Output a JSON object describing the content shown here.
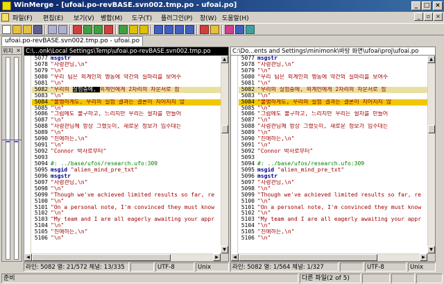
{
  "window": {
    "title": "WinMerge - [ufoai.po-revBASE.svn002.tmp.po - ufoai.po]",
    "minimize": "_",
    "maximize": "□",
    "close": "×"
  },
  "menu": {
    "items": [
      "파일(F)",
      "편집(E)",
      "보기(V)",
      "병합(M)",
      "도구(T)",
      "플러그인(P)",
      "창(W)",
      "도움말(H)"
    ],
    "mdi_minimize": "_",
    "mdi_restore": "▫",
    "mdi_close": "×"
  },
  "tab": {
    "label": "ufoai.po-revBASE.svn002.tmp.po - ufoai.po"
  },
  "location_pane": {
    "title": "위치",
    "close": "×"
  },
  "left_pane": {
    "path": "C:\\...onk\\Local Settings\\Temp\\ufoai.po-revBASE.svn002.tmp.po",
    "lines": [
      {
        "n": "5077",
        "parts": [
          {
            "t": "msgstr",
            "k": "k"
          }
        ]
      },
      {
        "n": "5078",
        "parts": [
          {
            "t": "\"사령관님,\\n\"",
            "k": "s"
          }
        ]
      },
      {
        "n": "5079",
        "parts": [
          {
            "t": "\"\\n\"",
            "k": "s"
          }
        ]
      },
      {
        "n": "5080",
        "parts": [
          {
            "t": "\"우리 팀은 외계인의 행동에 약간의 실마리를 보여주",
            "k": "s"
          }
        ]
      },
      {
        "n": "5081",
        "parts": [
          {
            "t": "\"\\n\"",
            "k": "s"
          }
        ]
      },
      {
        "n": "5082",
        "hl": "chg",
        "parts": [
          {
            "t": "\"우리의 ",
            "k": "s"
          },
          {
            "t": "실험중에, ",
            "k": "sel"
          },
          {
            "t": "외계인에게 2차리의 자문서로 잠",
            "k": "s"
          }
        ]
      },
      {
        "n": "5083",
        "parts": [
          {
            "t": "\"\\n\"",
            "k": "s"
          }
        ]
      },
      {
        "n": "5084",
        "hl": "yellow",
        "parts": [
          {
            "t": "\"불행하게도, 우리의 실험 결과는 결론이 지어지지 않",
            "k": "s"
          }
        ]
      },
      {
        "n": "5085",
        "parts": [
          {
            "t": "\"\\n\"",
            "k": "s"
          }
        ]
      },
      {
        "n": "5086",
        "parts": [
          {
            "t": "\"그럼에도 불구하고, 느리지만 우리는 절차를 만들어",
            "k": "s"
          }
        ]
      },
      {
        "n": "5087",
        "parts": [
          {
            "t": "\"\\n\"",
            "k": "s"
          }
        ]
      },
      {
        "n": "5088",
        "parts": [
          {
            "t": "\"사령관님께 항상 그랬듯이, 새로운 정보가 입수대는",
            "k": "s"
          }
        ]
      },
      {
        "n": "5089",
        "parts": [
          {
            "t": "\"\\n\"",
            "k": "s"
          }
        ]
      },
      {
        "n": "5090",
        "parts": [
          {
            "t": "\"친애하는,\\n\"",
            "k": "s"
          }
        ]
      },
      {
        "n": "5091",
        "parts": [
          {
            "t": "\"\\n\"",
            "k": "s"
          }
        ]
      },
      {
        "n": "5092",
        "parts": [
          {
            "t": "\"Connor 박사로부터\"",
            "k": "s"
          }
        ]
      },
      {
        "n": "5093",
        "parts": [
          {
            "t": "",
            "k": "s"
          }
        ]
      },
      {
        "n": "5094",
        "parts": [
          {
            "t": "#: ../base/ufos/research.ufo:309",
            "k": "c"
          }
        ]
      },
      {
        "n": "5095",
        "parts": [
          {
            "t": "msgid ",
            "k": "k"
          },
          {
            "t": "\"alien_mind_pre_txt\"",
            "k": "s"
          }
        ]
      },
      {
        "n": "5096",
        "parts": [
          {
            "t": "msgstr",
            "k": "k"
          }
        ]
      },
      {
        "n": "5097",
        "parts": [
          {
            "t": "\"사령관님,\\n\"",
            "k": "s"
          }
        ]
      },
      {
        "n": "5098",
        "parts": [
          {
            "t": "\"\\n\"",
            "k": "s"
          }
        ]
      },
      {
        "n": "5099",
        "parts": [
          {
            "t": "\"Though we've achieved limited results so far, re",
            "k": "s"
          }
        ]
      },
      {
        "n": "5100",
        "parts": [
          {
            "t": "\"\\n\"",
            "k": "s"
          }
        ]
      },
      {
        "n": "5101",
        "parts": [
          {
            "t": "\"On a personal note, I'm convinced they must know",
            "k": "s"
          }
        ]
      },
      {
        "n": "5102",
        "parts": [
          {
            "t": "\"\\n\"",
            "k": "s"
          }
        ]
      },
      {
        "n": "5103",
        "parts": [
          {
            "t": "\"My team and I are all eagerly awaiting your appr",
            "k": "s"
          }
        ]
      },
      {
        "n": "5104",
        "parts": [
          {
            "t": "\"\\n\"",
            "k": "s"
          }
        ]
      },
      {
        "n": "5105",
        "parts": [
          {
            "t": "\"친애하는,\\n\"",
            "k": "s"
          }
        ]
      },
      {
        "n": "5106",
        "parts": [
          {
            "t": "\"\\n\"",
            "k": "s"
          }
        ]
      }
    ],
    "status": {
      "pos": "라인: 5082  열: 21/572  체널: 13/335",
      "enc": "UTF-8",
      "eol": "Unix"
    }
  },
  "right_pane": {
    "path": "C:\\Do...ents and Settings\\minimonk\\바탕 화면\\ufoai\\proj\\ufoai.po",
    "lines": [
      {
        "n": "5077",
        "parts": [
          {
            "t": "msgstr",
            "k": "k"
          }
        ]
      },
      {
        "n": "5078",
        "parts": [
          {
            "t": "\"사령관님,\\n\"",
            "k": "s"
          }
        ]
      },
      {
        "n": "5079",
        "parts": [
          {
            "t": "\"\\n\"",
            "k": "s"
          }
        ]
      },
      {
        "n": "5080",
        "parts": [
          {
            "t": "\"우리 팀은 외계인의 행동에 약간의 실마리를 보여주",
            "k": "s"
          }
        ]
      },
      {
        "n": "5081",
        "parts": [
          {
            "t": "\"\\n\"",
            "k": "s"
          }
        ]
      },
      {
        "n": "5082",
        "hl": "chg",
        "parts": [
          {
            "t": "\"우리의 실험중에, 외계인에게 2차리의 자문서로 잠",
            "k": "s"
          }
        ]
      },
      {
        "n": "5083",
        "parts": [
          {
            "t": "\"\\n\"",
            "k": "s"
          }
        ]
      },
      {
        "n": "5084",
        "hl": "yellow",
        "parts": [
          {
            "t": "\"불행하게도, 우리의 실험 결과는 결론이 지어지지 않",
            "k": "s"
          }
        ]
      },
      {
        "n": "5085",
        "parts": [
          {
            "t": "\"\\n\"",
            "k": "s"
          }
        ]
      },
      {
        "n": "5086",
        "parts": [
          {
            "t": "\"그럼에도 불구하고, 느리지만 우리는 절차를 만들어",
            "k": "s"
          }
        ]
      },
      {
        "n": "5087",
        "parts": [
          {
            "t": "\"\\n\"",
            "k": "s"
          }
        ]
      },
      {
        "n": "5088",
        "parts": [
          {
            "t": "\"사령관님께 항상 그랬듯이, 새로운 정보가 입수대는",
            "k": "s"
          }
        ]
      },
      {
        "n": "5089",
        "parts": [
          {
            "t": "\"\\n\"",
            "k": "s"
          }
        ]
      },
      {
        "n": "5090",
        "parts": [
          {
            "t": "\"친애하는,\\n\"",
            "k": "s"
          }
        ]
      },
      {
        "n": "5091",
        "parts": [
          {
            "t": "\"\\n\"",
            "k": "s"
          }
        ]
      },
      {
        "n": "5092",
        "parts": [
          {
            "t": "\"Connor 박사로부터\"",
            "k": "s"
          }
        ]
      },
      {
        "n": "5093",
        "parts": [
          {
            "t": "",
            "k": "s"
          }
        ]
      },
      {
        "n": "5094",
        "parts": [
          {
            "t": "#: ../base/ufos/research.ufo:309",
            "k": "c"
          }
        ]
      },
      {
        "n": "5095",
        "parts": [
          {
            "t": "msgid ",
            "k": "k"
          },
          {
            "t": "\"alien_mind_pre_txt\"",
            "k": "s"
          }
        ]
      },
      {
        "n": "5096",
        "parts": [
          {
            "t": "msgstr",
            "k": "k"
          }
        ]
      },
      {
        "n": "5097",
        "parts": [
          {
            "t": "\"사령관님,\\n\"",
            "k": "s"
          }
        ]
      },
      {
        "n": "5098",
        "parts": [
          {
            "t": "\"\\n\"",
            "k": "s"
          }
        ]
      },
      {
        "n": "5099",
        "parts": [
          {
            "t": "\"Though we've achieved limited results so far, re",
            "k": "s"
          }
        ]
      },
      {
        "n": "5100",
        "parts": [
          {
            "t": "\"\\n\"",
            "k": "s"
          }
        ]
      },
      {
        "n": "5101",
        "parts": [
          {
            "t": "\"On a personal note, I'm convinced they must know",
            "k": "s"
          }
        ]
      },
      {
        "n": "5102",
        "parts": [
          {
            "t": "\"\\n\"",
            "k": "s"
          }
        ]
      },
      {
        "n": "5103",
        "parts": [
          {
            "t": "\"My team and I are all eagerly awaiting your appr",
            "k": "s"
          }
        ]
      },
      {
        "n": "5104",
        "parts": [
          {
            "t": "\"\\n\"",
            "k": "s"
          }
        ]
      },
      {
        "n": "5105",
        "parts": [
          {
            "t": "\"친애하는,\\n\"",
            "k": "s"
          }
        ]
      },
      {
        "n": "5106",
        "parts": [
          {
            "t": "\"\\n\"",
            "k": "s"
          }
        ]
      }
    ],
    "status": {
      "pos": "라인: 5082  열: 1/564  체널: 1/327",
      "enc": "UTF-8",
      "eol": "Unix"
    }
  },
  "statusbar": {
    "ready": "준비",
    "diff_info": "다른 파일(2 of 5)"
  },
  "colors": {
    "titlebar": "#0a246a",
    "diff_yellow": "#f0c800",
    "keyword": "#00008b",
    "string": "#a00000",
    "comment": "#008000"
  }
}
